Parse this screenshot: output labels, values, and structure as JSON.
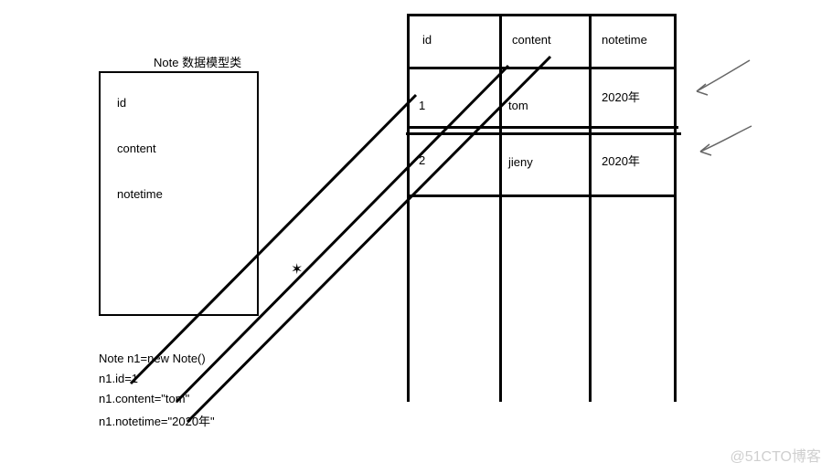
{
  "classBox": {
    "title": "Note 数据模型类",
    "fields": {
      "id": "id",
      "content": "content",
      "notetime": "notetime"
    }
  },
  "code": {
    "line1": "Note n1=new Note()",
    "line2": "n1.id=1",
    "line3": "n1.content=\"tom\"",
    "line4": "n1.notetime=\"2020年\""
  },
  "table": {
    "headers": {
      "c1": "id",
      "c2": "content",
      "c3": "notetime"
    },
    "rows": [
      {
        "id": "1",
        "content": "tom",
        "notetime": "2020年"
      },
      {
        "id": "2",
        "content": "jieny",
        "notetime": "2020年"
      }
    ]
  },
  "crossMarker": "✶",
  "watermark": "@51CTO博客"
}
